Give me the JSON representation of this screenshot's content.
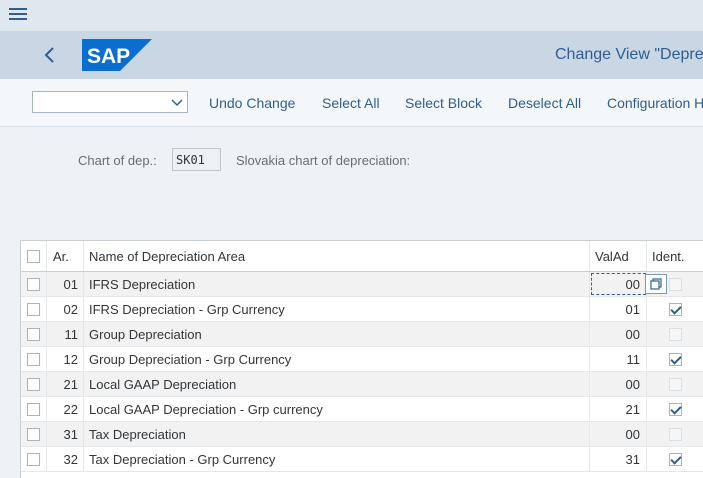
{
  "shell": {
    "title": "Change View \"Depre",
    "logo_text": "SAP"
  },
  "toolbar": {
    "select_value": "",
    "undo_change": "Undo Change",
    "select_all": "Select All",
    "select_block": "Select Block",
    "deselect_all": "Deselect All",
    "configuration": "Configuration H"
  },
  "header": {
    "chart_label": "Chart of dep.:",
    "chart_value": "SK01",
    "chart_desc": "Slovakia chart of depreciation:"
  },
  "table": {
    "columns": {
      "ar": "Ar.",
      "name": "Name of Depreciation Area",
      "valad": "ValAd",
      "ident": "Ident."
    },
    "rows": [
      {
        "ar": "01",
        "name": "IFRS Depreciation",
        "valad": "00",
        "ident": false,
        "ident_enabled": false
      },
      {
        "ar": "02",
        "name": "IFRS Depreciation - Grp Currency",
        "valad": "01",
        "ident": true,
        "ident_enabled": true
      },
      {
        "ar": "11",
        "name": "Group Depreciation",
        "valad": "00",
        "ident": false,
        "ident_enabled": false
      },
      {
        "ar": "12",
        "name": "Group Depreciation - Grp Currency",
        "valad": "11",
        "ident": true,
        "ident_enabled": true
      },
      {
        "ar": "21",
        "name": "Local GAAP Depreciation",
        "valad": "00",
        "ident": false,
        "ident_enabled": false
      },
      {
        "ar": "22",
        "name": "Local GAAP Depreciation - Grp currency",
        "valad": "21",
        "ident": true,
        "ident_enabled": true
      },
      {
        "ar": "31",
        "name": "Tax Depreciation",
        "valad": "00",
        "ident": false,
        "ident_enabled": false
      },
      {
        "ar": "32",
        "name": "Tax Depreciation - Grp Currency",
        "valad": "31",
        "ident": true,
        "ident_enabled": true
      }
    ]
  }
}
